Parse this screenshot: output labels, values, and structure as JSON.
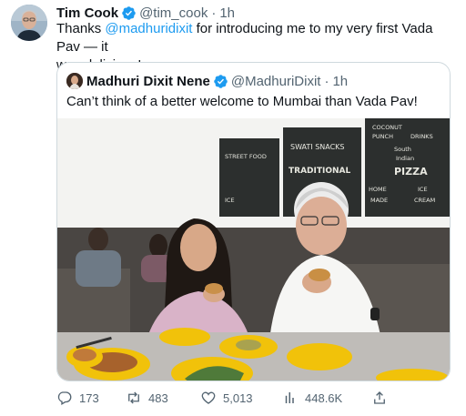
{
  "tweet": {
    "author_name": "Tim Cook",
    "handle": "@tim_cook",
    "separator": "·",
    "time": "1h",
    "text_prefix": "Thanks ",
    "mention": "@madhuridixit",
    "text_line1_rest": " for introducing me to my very first Vada Pav — it",
    "text_line2": "was delicious!"
  },
  "quote": {
    "author_name": "Madhuri Dixit Nene",
    "handle": "@MadhuriDixit",
    "separator": "·",
    "time": "1h",
    "text": "Can’t think of a better welcome to Mumbai than Vada Pav!",
    "photo": {
      "board_left": [
        "STREET FOOD",
        "ICE"
      ],
      "board_mid": [
        "SWATI SNACKS",
        "TRADITIONAL"
      ],
      "board_right": [
        "COCONUT",
        "PUNCH",
        "DRINKS",
        "South",
        "Indian",
        "PIZZA",
        "HOME",
        "MADE",
        "ICE",
        "CREAM"
      ]
    }
  },
  "actions": {
    "replies": "173",
    "retweets": "483",
    "likes": "5,013",
    "views": "448.6K"
  },
  "colors": {
    "accent": "#1d9bf0",
    "muted": "#536471",
    "border": "#cfd9de"
  },
  "icons": {
    "verified": "verified-badge-icon",
    "reply": "reply-icon",
    "retweet": "retweet-icon",
    "like": "heart-icon",
    "views": "views-icon",
    "share": "share-icon"
  }
}
